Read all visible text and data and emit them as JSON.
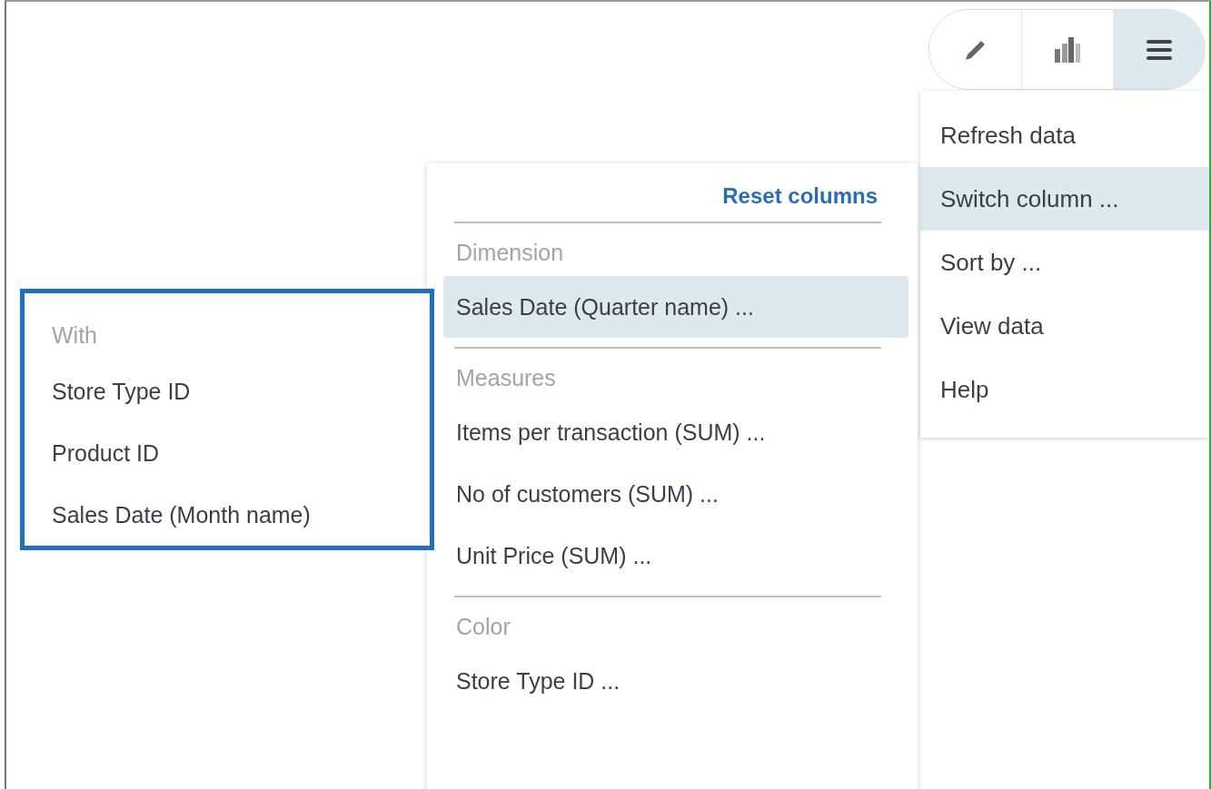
{
  "toolbar": [
    {
      "kind": "edit",
      "selected": false
    },
    {
      "kind": "chart",
      "selected": false
    },
    {
      "kind": "menu",
      "selected": true
    }
  ],
  "menu": [
    {
      "label": "Refresh data",
      "selected": false
    },
    {
      "label": "Switch column ...",
      "selected": true
    },
    {
      "label": "Sort by ...",
      "selected": false
    },
    {
      "label": "View data",
      "selected": false
    },
    {
      "label": "Help",
      "selected": false
    }
  ],
  "column_panel": {
    "reset_link": "Reset columns",
    "sections": [
      {
        "title": "Dimension",
        "items": [
          {
            "label": "Sales Date (Quarter name) ...",
            "selected": true
          }
        ]
      },
      {
        "title": "Measures",
        "items": [
          {
            "label": "Items per transaction (SUM) ...",
            "selected": false
          },
          {
            "label": "No of customers (SUM) ...",
            "selected": false
          },
          {
            "label": "Unit Price (SUM) ...",
            "selected": false
          }
        ]
      },
      {
        "title": "Color",
        "items": [
          {
            "label": "Store Type ID ...",
            "selected": false
          }
        ]
      }
    ]
  },
  "with_panel": {
    "title": "With",
    "items": [
      {
        "label": "Store Type ID"
      },
      {
        "label": "Product ID"
      },
      {
        "label": "Sales Date (Month name)"
      }
    ]
  }
}
